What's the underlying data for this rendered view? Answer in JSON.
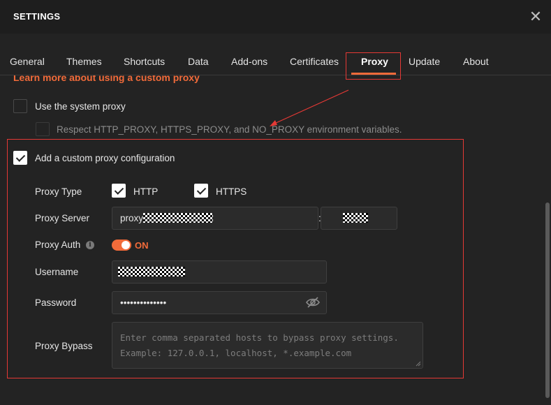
{
  "window": {
    "title": "SETTINGS",
    "close_icon": "close-icon"
  },
  "tabs": [
    {
      "label": "General"
    },
    {
      "label": "Themes"
    },
    {
      "label": "Shortcuts"
    },
    {
      "label": "Data"
    },
    {
      "label": "Add-ons"
    },
    {
      "label": "Certificates"
    },
    {
      "label": "Proxy",
      "active": true
    },
    {
      "label": "Update"
    },
    {
      "label": "About"
    }
  ],
  "proxy": {
    "learn_more_link": "Learn more about using a custom proxy",
    "use_system_proxy": {
      "label": "Use the system proxy",
      "checked": false
    },
    "respect_env": {
      "label": "Respect HTTP_PROXY, HTTPS_PROXY, and NO_PROXY environment variables.",
      "checked": false,
      "disabled": true
    },
    "custom_proxy": {
      "label": "Add a custom proxy configuration",
      "checked": true
    },
    "proxy_type": {
      "label": "Proxy Type",
      "http": {
        "label": "HTTP",
        "checked": true
      },
      "https": {
        "label": "HTTPS",
        "checked": true
      }
    },
    "proxy_server": {
      "label": "Proxy Server",
      "host_value": "proxy",
      "separator": ":"
    },
    "proxy_auth": {
      "label": "Proxy Auth",
      "state": "ON",
      "enabled": true
    },
    "username": {
      "label": "Username"
    },
    "password": {
      "label": "Password",
      "value": "••••••••••••••"
    },
    "proxy_bypass": {
      "label": "Proxy Bypass",
      "placeholder_line1": "Enter comma separated hosts to bypass proxy settings.",
      "placeholder_line2": "Example: 127.0.0.1, localhost, *.example.com"
    }
  },
  "colors": {
    "accent": "#f26b3a",
    "annotation_red": "#e53935",
    "background": "#232323"
  }
}
